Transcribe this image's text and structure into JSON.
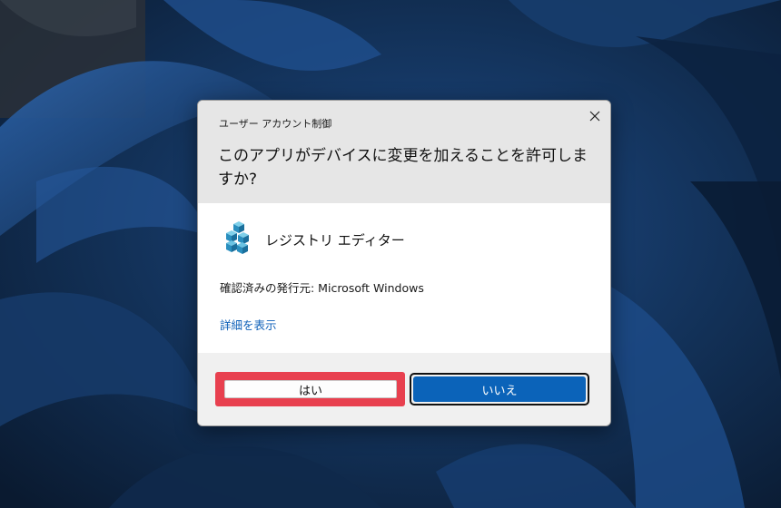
{
  "dialog": {
    "caption": "ユーザー アカウント制御",
    "question": "このアプリがデバイスに変更を加えることを許可しますか?",
    "close_icon": "close-icon",
    "app": {
      "name": "レジストリ エディター",
      "icon": "registry-editor-icon"
    },
    "publisher": "確認済みの発行元: Microsoft Windows",
    "details_link": "詳細を表示",
    "buttons": {
      "yes": "はい",
      "no": "いいえ"
    }
  },
  "colors": {
    "accent": "#0b63b9",
    "highlight": "#e8404f",
    "header_bg": "#e6e6e6",
    "footer_bg": "#f0f0f0",
    "link": "#0d5fb8"
  }
}
